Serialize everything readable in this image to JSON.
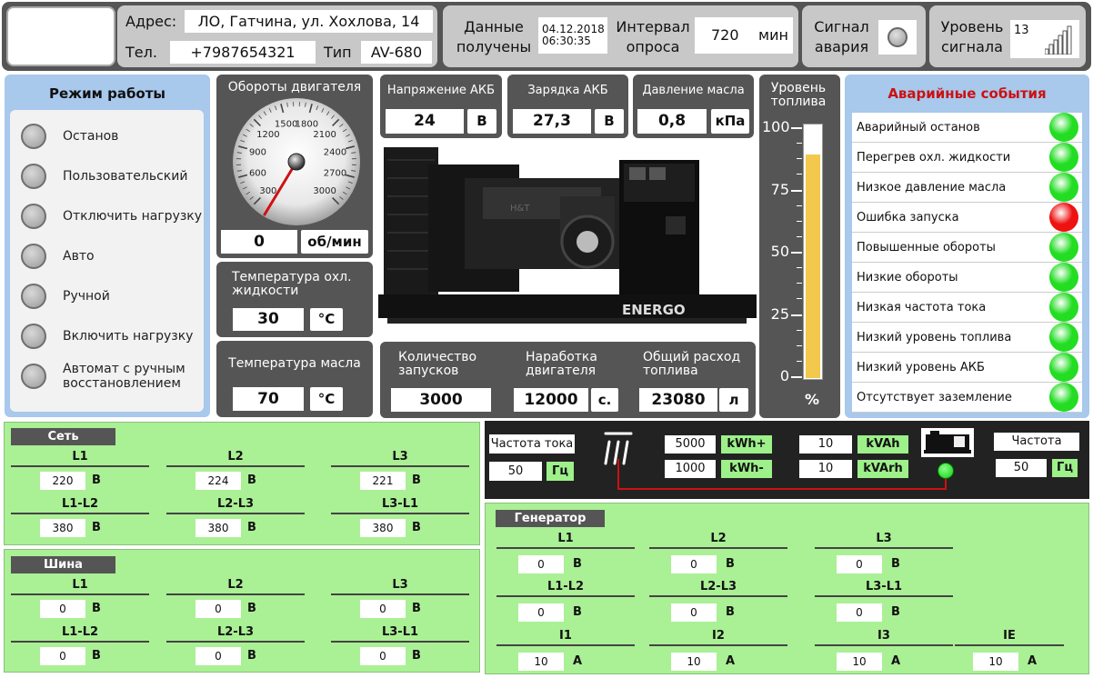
{
  "header": {
    "address_label": "Адрес:",
    "address_value": "ЛО, Гатчина, ул. Хохлова, 14",
    "phone_label": "Тел.",
    "phone_value": "+7987654321",
    "type_label": "Тип",
    "type_value": "AV-680",
    "data_received_label": "Данные получены",
    "data_received_date": "04.12.2018",
    "data_received_time": "06:30:35",
    "poll_interval_label": "Интервал опроса",
    "poll_interval_value": "720",
    "poll_interval_unit": "мин",
    "alarm_signal_label": "Сигнал авария",
    "signal_level_label": "Уровень сигнала",
    "signal_level_value": "13"
  },
  "mode": {
    "title": "Режим работы",
    "items": [
      "Останов",
      "Пользовательский",
      "Отключить нагрузку",
      "Авто",
      "Ручной",
      "Включить нагрузку",
      "Автомат с ручным восстановлением"
    ]
  },
  "rpm": {
    "title": "Обороты двигателя",
    "value": "0",
    "unit": "об/мин",
    "ticks": [
      "300",
      "600",
      "900",
      "1200",
      "1500",
      "1800",
      "2100",
      "2400",
      "2700",
      "3000"
    ]
  },
  "coolant": {
    "title": "Температура охл. жидкости",
    "value": "30",
    "unit": "°C"
  },
  "oil_temp": {
    "title": "Температура масла",
    "value": "70",
    "unit": "°C"
  },
  "battery_voltage": {
    "title": "Напряжение АКБ",
    "value": "24",
    "unit": "В"
  },
  "battery_charge": {
    "title": "Зарядка АКБ",
    "value": "27,3",
    "unit": "В"
  },
  "oil_pressure": {
    "title": "Давление масла",
    "value": "0,8",
    "unit": "кПа"
  },
  "generator_image_brand": "ENERGO",
  "starts": {
    "title": "Количество запусков",
    "value": "3000"
  },
  "runtime": {
    "title": "Наработка двигателя",
    "value": "12000",
    "unit": "с."
  },
  "fuel_total": {
    "title": "Общий расход топлива",
    "value": "23080",
    "unit": "л"
  },
  "fuel_level": {
    "title": "Уровень топлива",
    "ticks": [
      "100",
      "75",
      "50",
      "25",
      "0"
    ],
    "unit": "%",
    "level_percent": 88
  },
  "events": {
    "title": "Аварийные события",
    "items": [
      {
        "label": "Аварийный останов",
        "status": "green"
      },
      {
        "label": "Перегрев охл. жидкости",
        "status": "green"
      },
      {
        "label": "Низкое давление масла",
        "status": "green"
      },
      {
        "label": "Ошибка запуска",
        "status": "red"
      },
      {
        "label": "Повышенные обороты",
        "status": "green"
      },
      {
        "label": "Низкие обороты",
        "status": "green"
      },
      {
        "label": "Низкая частота тока",
        "status": "green"
      },
      {
        "label": "Низкий уровень топлива",
        "status": "green"
      },
      {
        "label": "Низкий уровень АКБ",
        "status": "green"
      },
      {
        "label": "Отсутствует заземление",
        "status": "green"
      }
    ]
  },
  "net": {
    "title": "Сеть",
    "l": [
      "L1",
      "L2",
      "L3"
    ],
    "ll": [
      "L1-L2",
      "L2-L3",
      "L3-L1"
    ],
    "l_values": [
      "220",
      "224",
      "221"
    ],
    "ll_values": [
      "380",
      "380",
      "380"
    ],
    "unit": "В"
  },
  "bus": {
    "title": "Шина",
    "l": [
      "L1",
      "L2",
      "L3"
    ],
    "ll": [
      "L1-L2",
      "L2-L3",
      "L3-L1"
    ],
    "l_values": [
      "0",
      "0",
      "0"
    ],
    "ll_values": [
      "0",
      "0",
      "0"
    ],
    "unit": "В"
  },
  "energy": {
    "freq_left_label": "Частота тока",
    "freq_left_value": "50",
    "freq_unit": "Гц",
    "kwh_plus_value": "5000",
    "kwh_plus_unit": "kWh+",
    "kwh_minus_value": "1000",
    "kwh_minus_unit": "kWh-",
    "kvah_value": "10",
    "kvah_unit": "kVAh",
    "kvarh_value": "10",
    "kvarh_unit": "kVArh",
    "freq_right_label": "Частота",
    "freq_right_value": "50"
  },
  "generator": {
    "title": "Генератор",
    "l": [
      "L1",
      "L2",
      "L3"
    ],
    "ll": [
      "L1-L2",
      "L2-L3",
      "L3-L1"
    ],
    "i": [
      "I1",
      "I2",
      "I3",
      "IE"
    ],
    "l_values": [
      "0",
      "0",
      "0"
    ],
    "ll_values": [
      "0",
      "0",
      "0"
    ],
    "i_values": [
      "10",
      "10",
      "10",
      "10"
    ],
    "v_unit": "В",
    "a_unit": "А"
  },
  "colors": {
    "panel_gray": "#555555",
    "panel_green": "#aaf095",
    "led_green": "#22dd22",
    "led_red": "#ee1111",
    "fuel": "#f2c94c",
    "event_title": "#cc1111"
  }
}
